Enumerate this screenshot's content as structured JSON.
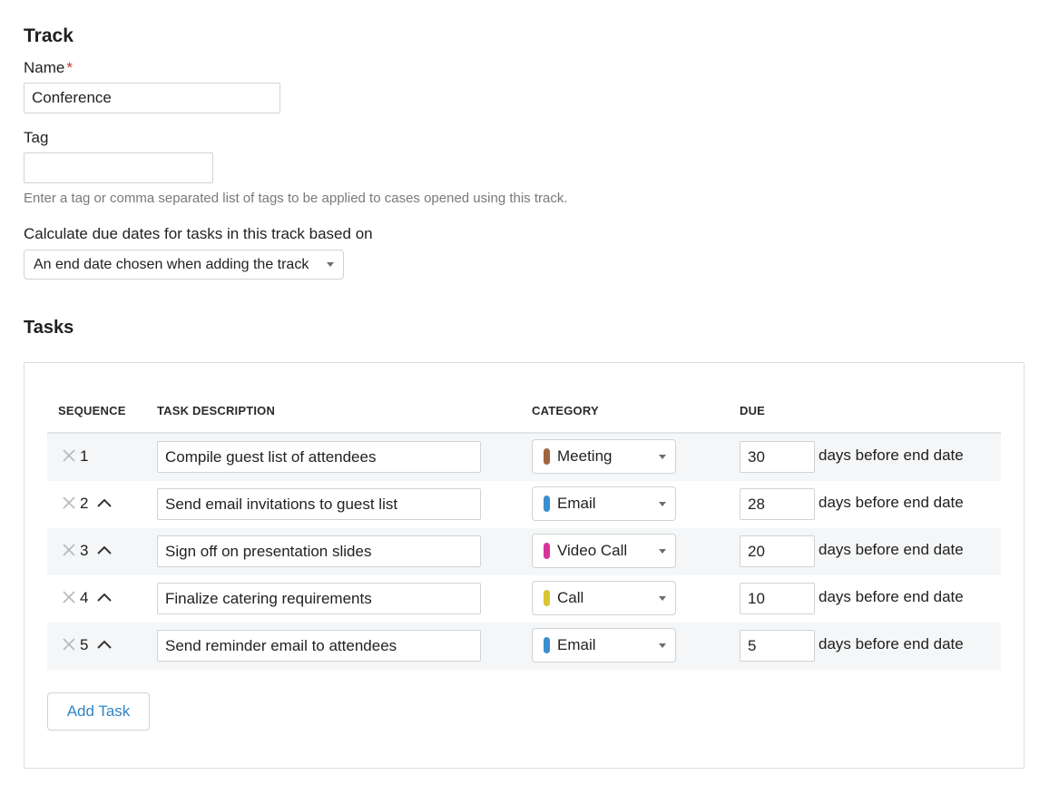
{
  "track": {
    "title": "Track",
    "name_label": "Name",
    "required_marker": "*",
    "name_value": "Conference",
    "tag_label": "Tag",
    "tag_value": "",
    "tag_help": "Enter a tag or comma separated list of tags to be applied to cases opened using this track.",
    "due_basis_label": "Calculate due dates for tasks in this track based on",
    "due_basis_selected": "An end date chosen when adding the track"
  },
  "tasks": {
    "title": "Tasks",
    "columns": {
      "sequence": "SEQUENCE",
      "description": "TASK DESCRIPTION",
      "category": "CATEGORY",
      "due": "DUE"
    },
    "rows": [
      {
        "seq": "1",
        "description": "Compile guest list of attendees",
        "category": "Meeting",
        "category_color": "#a0653f",
        "due": "30",
        "due_suffix": "days before end date"
      },
      {
        "seq": "2",
        "description": "Send email invitations to guest list",
        "category": "Email",
        "category_color": "#3b8fd0",
        "due": "28",
        "due_suffix": "days before end date"
      },
      {
        "seq": "3",
        "description": "Sign off on presentation slides",
        "category": "Video Call",
        "category_color": "#d6359c",
        "due": "20",
        "due_suffix": "days before end date"
      },
      {
        "seq": "4",
        "description": "Finalize catering requirements",
        "category": "Call",
        "category_color": "#d9c632",
        "due": "10",
        "due_suffix": "days before end date"
      },
      {
        "seq": "5",
        "description": "Send reminder email to attendees",
        "category": "Email",
        "category_color": "#3b8fd0",
        "due": "5",
        "due_suffix": "days before end date"
      }
    ],
    "add_button_label": "Add Task"
  },
  "colors": {
    "link_blue": "#2f86c6",
    "required_red": "#c0392b",
    "row_shade": "#f5f6f7"
  },
  "icons": {
    "remove": "close-icon",
    "move_up": "chevron-up-icon",
    "dropdown": "caret-down-icon"
  }
}
